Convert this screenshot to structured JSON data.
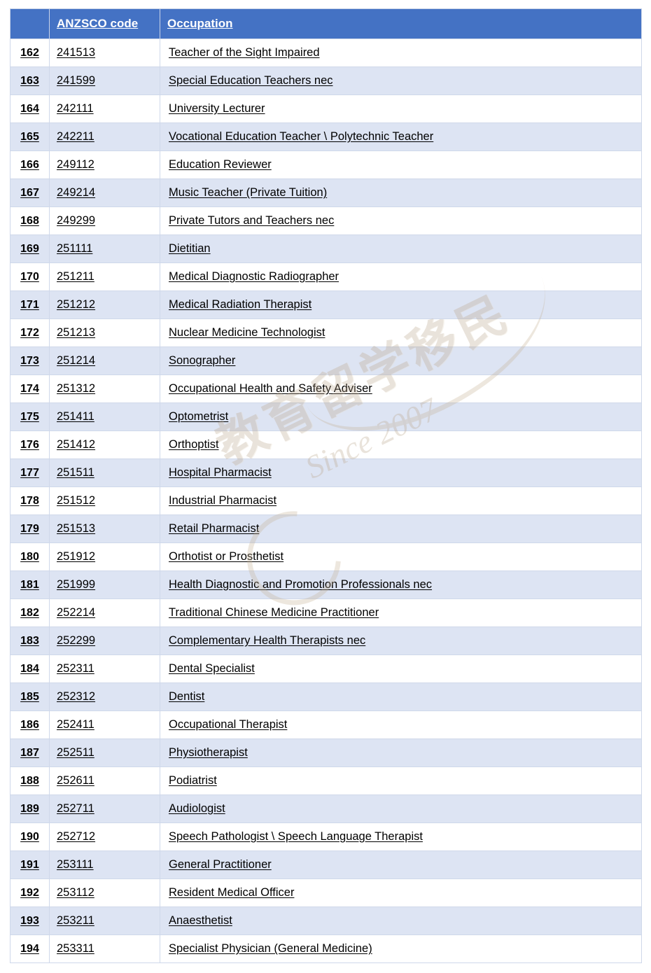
{
  "table": {
    "headers": {
      "index": "",
      "code": "ANZSCO code",
      "occupation": "Occupation"
    },
    "rows": [
      {
        "index": "162",
        "code": "241513",
        "occupation": "Teacher of the Sight Impaired"
      },
      {
        "index": "163",
        "code": "241599",
        "occupation": "Special Education Teachers nec"
      },
      {
        "index": "164",
        "code": "242111",
        "occupation": "University Lecturer"
      },
      {
        "index": "165",
        "code": "242211",
        "occupation": "Vocational Education Teacher \\ Polytechnic Teacher"
      },
      {
        "index": "166",
        "code": "249112",
        "occupation": "Education Reviewer"
      },
      {
        "index": "167",
        "code": "249214",
        "occupation": "Music Teacher (Private Tuition)"
      },
      {
        "index": "168",
        "code": "249299",
        "occupation": "Private Tutors and Teachers nec"
      },
      {
        "index": "169",
        "code": "251111",
        "occupation": "Dietitian"
      },
      {
        "index": "170",
        "code": "251211",
        "occupation": "Medical Diagnostic Radiographer"
      },
      {
        "index": "171",
        "code": "251212",
        "occupation": "Medical Radiation Therapist"
      },
      {
        "index": "172",
        "code": "251213",
        "occupation": "Nuclear Medicine Technologist"
      },
      {
        "index": "173",
        "code": "251214",
        "occupation": "Sonographer"
      },
      {
        "index": "174",
        "code": "251312",
        "occupation": "Occupational Health and Safety Adviser"
      },
      {
        "index": "175",
        "code": "251411",
        "occupation": "Optometrist"
      },
      {
        "index": "176",
        "code": "251412",
        "occupation": "Orthoptist"
      },
      {
        "index": "177",
        "code": "251511",
        "occupation": "Hospital Pharmacist"
      },
      {
        "index": "178",
        "code": "251512",
        "occupation": "Industrial Pharmacist"
      },
      {
        "index": "179",
        "code": "251513",
        "occupation": "Retail Pharmacist"
      },
      {
        "index": "180",
        "code": "251912",
        "occupation": "Orthotist or Prosthetist"
      },
      {
        "index": "181",
        "code": "251999",
        "occupation": "Health Diagnostic and Promotion Professionals nec"
      },
      {
        "index": "182",
        "code": "252214",
        "occupation": "Traditional Chinese Medicine Practitioner"
      },
      {
        "index": "183",
        "code": "252299",
        "occupation": "Complementary Health Therapists nec"
      },
      {
        "index": "184",
        "code": "252311",
        "occupation": "Dental Specialist"
      },
      {
        "index": "185",
        "code": "252312",
        "occupation": "Dentist"
      },
      {
        "index": "186",
        "code": "252411",
        "occupation": "Occupational Therapist"
      },
      {
        "index": "187",
        "code": "252511",
        "occupation": "Physiotherapist"
      },
      {
        "index": "188",
        "code": "252611",
        "occupation": "Podiatrist"
      },
      {
        "index": "189",
        "code": "252711",
        "occupation": "Audiologist"
      },
      {
        "index": "190",
        "code": "252712",
        "occupation": "Speech Pathologist \\ Speech Language Therapist"
      },
      {
        "index": "191",
        "code": "253111",
        "occupation": "General Practitioner"
      },
      {
        "index": "192",
        "code": "253112",
        "occupation": "Resident Medical Officer"
      },
      {
        "index": "193",
        "code": "253211",
        "occupation": "Anaesthetist"
      },
      {
        "index": "194",
        "code": "253311",
        "occupation": "Specialist Physician (General Medicine)"
      }
    ]
  },
  "watermark": {
    "chinese_text": "教育留学移民",
    "since_text": "Since 2007"
  },
  "colors": {
    "header_background": "#4472c4",
    "header_text": "#ffffff",
    "row_alt_background": "#dde4f3",
    "border": "#cfd8ea",
    "watermark": "#b9a489"
  }
}
